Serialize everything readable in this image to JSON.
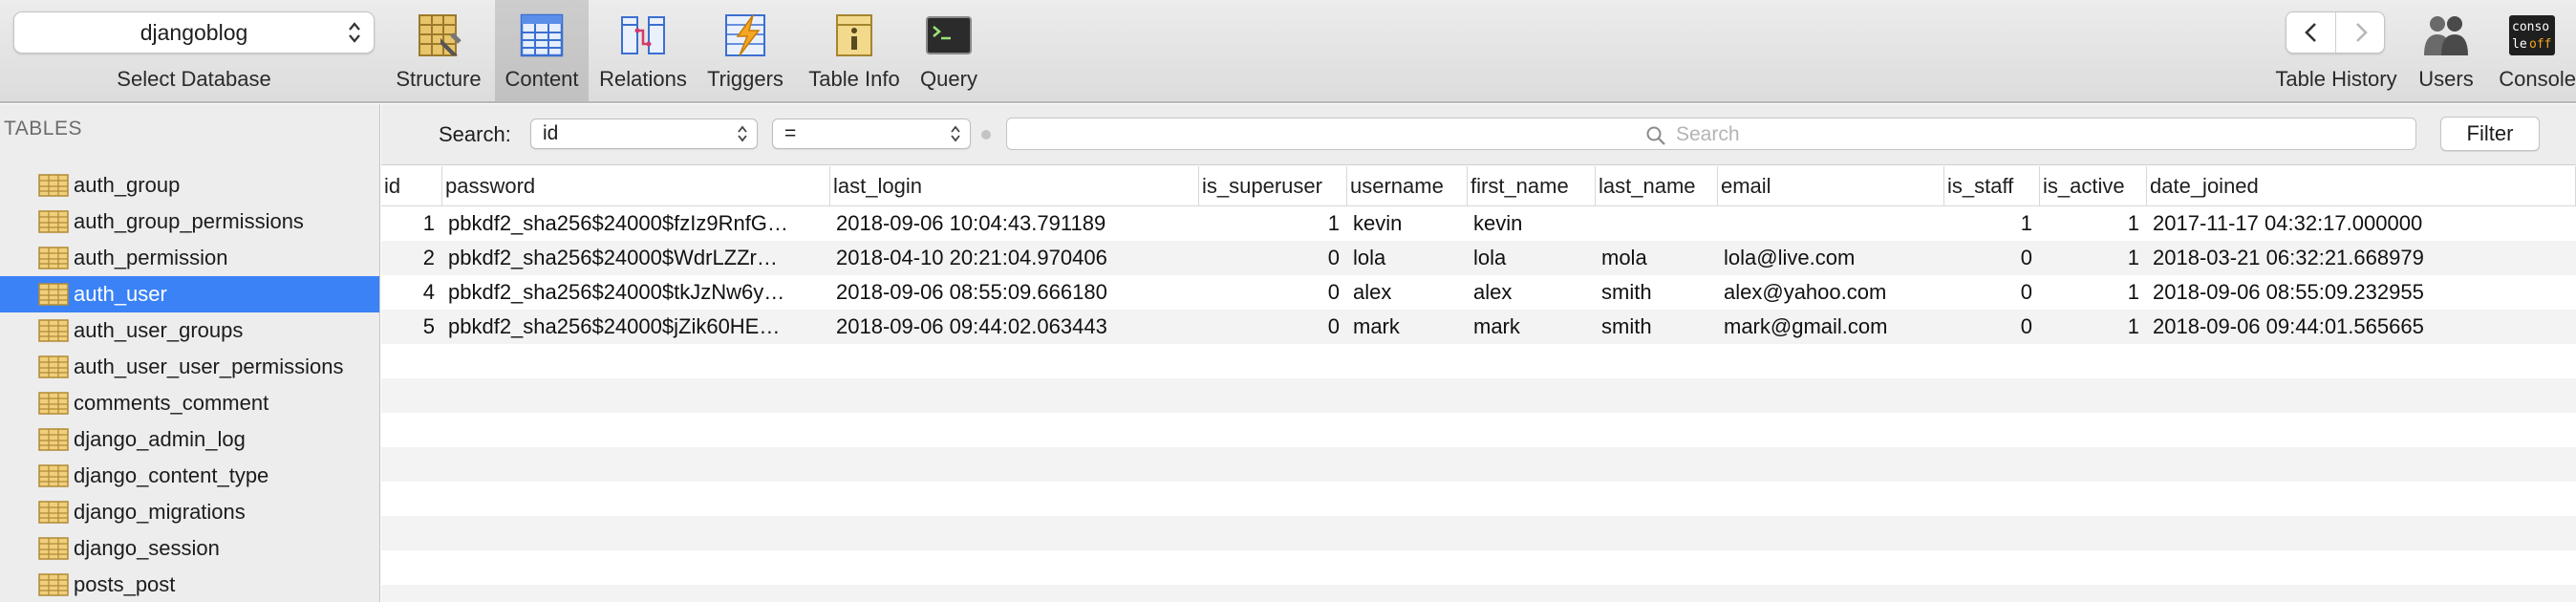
{
  "toolbar": {
    "database": "djangoblog",
    "database_label": "Select Database",
    "buttons": [
      {
        "label": "Structure",
        "icon": "structure-icon"
      },
      {
        "label": "Content",
        "icon": "content-icon"
      },
      {
        "label": "Relations",
        "icon": "relations-icon"
      },
      {
        "label": "Triggers",
        "icon": "triggers-icon"
      },
      {
        "label": "Table Info",
        "icon": "table-info-icon"
      },
      {
        "label": "Query",
        "icon": "query-icon"
      }
    ],
    "active_button": "Content",
    "right_buttons": [
      {
        "label": "Table History",
        "icon": "table-history-icon"
      },
      {
        "label": "Users",
        "icon": "users-icon"
      },
      {
        "label": "Console",
        "icon": "console-icon",
        "badge_line1": "conso",
        "badge_line2": "le",
        "badge_line3": "off"
      }
    ]
  },
  "sidebar": {
    "header": "TABLES",
    "items": [
      "auth_group",
      "auth_group_permissions",
      "auth_permission",
      "auth_user",
      "auth_user_groups",
      "auth_user_user_permissions",
      "comments_comment",
      "django_admin_log",
      "django_content_type",
      "django_migrations",
      "django_session",
      "posts_post"
    ],
    "selected": "auth_user"
  },
  "filter": {
    "label": "Search:",
    "field": "id",
    "operator": "=",
    "search_placeholder": "Search",
    "filter_button": "Filter"
  },
  "table": {
    "columns": [
      "id",
      "password",
      "last_login",
      "is_superuser",
      "username",
      "first_name",
      "last_name",
      "email",
      "is_staff",
      "is_active",
      "date_joined"
    ],
    "rows": [
      [
        "1",
        "pbkdf2_sha256$24000$fzIz9RnfG…",
        "2018-09-06 10:04:43.791189",
        "1",
        "kevin",
        "kevin",
        "",
        "",
        "1",
        "1",
        "2017-11-17 04:32:17.000000"
      ],
      [
        "2",
        "pbkdf2_sha256$24000$WdrLZZr…",
        "2018-04-10 20:21:04.970406",
        "0",
        "lola",
        "lola",
        "mola",
        "lola@live.com",
        "0",
        "1",
        "2018-03-21 06:32:21.668979"
      ],
      [
        "4",
        "pbkdf2_sha256$24000$tkJzNw6y…",
        "2018-09-06 08:55:09.666180",
        "0",
        "alex",
        "alex",
        "smith",
        "alex@yahoo.com",
        "0",
        "1",
        "2018-09-06 08:55:09.232955"
      ],
      [
        "5",
        "pbkdf2_sha256$24000$jZik60HE…",
        "2018-09-06 09:44:02.063443",
        "0",
        "mark",
        "mark",
        "smith",
        "mark@gmail.com",
        "0",
        "1",
        "2018-09-06 09:44:01.565665"
      ]
    ]
  },
  "colors": {
    "selection": "#3a82f6",
    "toolbar_bg": "#e3e3e3",
    "sidebar_bg": "#ededed",
    "row_alt": "#f3f3f3"
  }
}
